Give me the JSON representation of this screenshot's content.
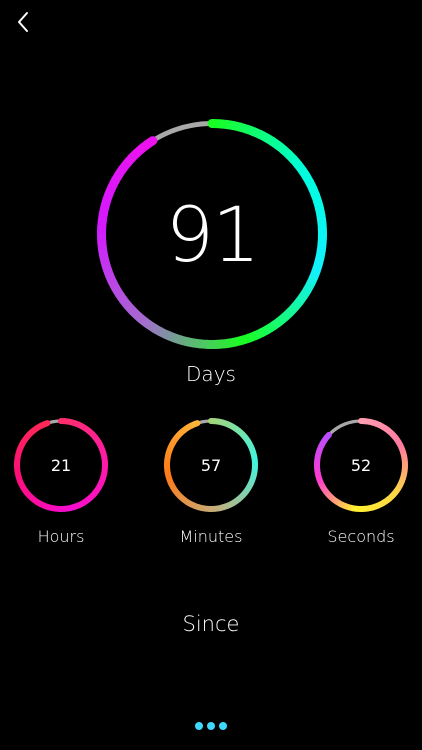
{
  "nav": {
    "back_icon": "chevron-left-icon"
  },
  "main_counter": {
    "value": "91",
    "label": "Days",
    "progress": 0.91,
    "gradient_colors": [
      "#19ff1f",
      "#00ffdd",
      "#13f0ff",
      "#19ff1f",
      "#a56bd0",
      "#d21bff",
      "#ee12ee"
    ]
  },
  "counters": [
    {
      "value": "21",
      "label": "Hours",
      "progress": 0.95,
      "gradient_colors": [
        "#ff2e6a",
        "#ff1aa8",
        "#f70dd0",
        "#ff0f77",
        "#ff2a55"
      ]
    },
    {
      "value": "57",
      "label": "Minutes",
      "progress": 0.95,
      "gradient_colors": [
        "#a5d57a",
        "#40f5e0",
        "#c2b080",
        "#ff7a18",
        "#ffb33a"
      ]
    },
    {
      "value": "52",
      "label": "Seconds",
      "progress": 0.87,
      "gradient_colors": [
        "#ff9fb0",
        "#ff7aa0",
        "#ffd24a",
        "#fff22e",
        "#ff3bd0",
        "#b84dff"
      ]
    }
  ],
  "footer": {
    "since_label": "Since"
  },
  "page_indicator": {
    "count": 3,
    "color": "#3ed8ff"
  },
  "colors": {
    "background": "#000000",
    "track": "#a8a8a8",
    "text": "#ffffff"
  }
}
